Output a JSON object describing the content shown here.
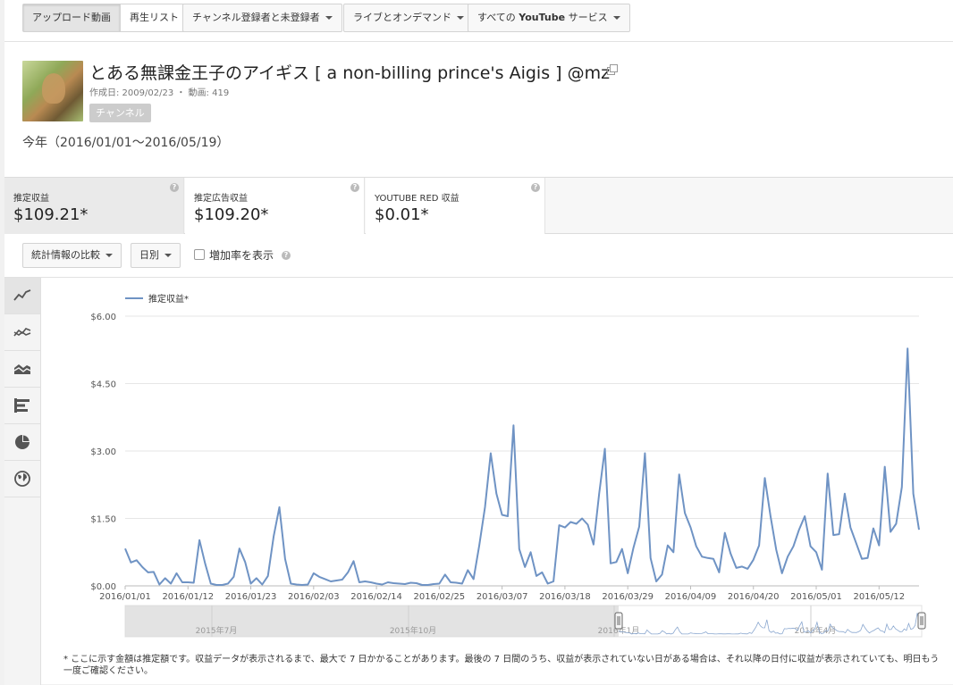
{
  "filter_bar": {
    "upload_videos": "アップロード動画",
    "playlists": "再生リスト",
    "subscribers_filter": "チャンネル登録者と未登録者",
    "live_filter": "ライブとオンデマンド",
    "services_prefix": "すべての ",
    "services_bold": "YouTube",
    "services_suffix": " サービス"
  },
  "channel": {
    "title": "とある無課金王子のアイギス [ a non-billing prince's Aigis ] @mz",
    "meta": "作成日: 2009/02/23 ・ 動画: 419",
    "badge": "チャンネル",
    "period": "今年（2016/01/01〜2016/05/19）"
  },
  "metrics": [
    {
      "label": "推定収益",
      "value": "$109.21*"
    },
    {
      "label": "推定広告収益",
      "value": "$109.20*"
    },
    {
      "label": "YOUTUBE RED 収益",
      "value": "$0.01*"
    }
  ],
  "controls": {
    "compare": "統計情報の比較",
    "granularity": "日別",
    "growth_label": "増加率を表示"
  },
  "side_tools": [
    "line-chart-icon",
    "multi-line-chart-icon",
    "stacked-area-chart-icon",
    "bar-chart-icon",
    "pie-chart-icon",
    "globe-map-icon"
  ],
  "chart_data": {
    "type": "line",
    "title": "",
    "legend": "推定収益*",
    "legend_position": "top-left",
    "grid": true,
    "ylim": [
      0,
      6
    ],
    "y_ticks": [
      "$0.00",
      "$1.50",
      "$3.00",
      "$4.50",
      "$6.00"
    ],
    "x_ticks": [
      "2016/01/01",
      "2016/01/12",
      "2016/01/23",
      "2016/02/03",
      "2016/02/14",
      "2016/02/25",
      "2016/03/07",
      "2016/03/18",
      "2016/03/29",
      "2016/04/09",
      "2016/04/20",
      "2016/05/01",
      "2016/05/12"
    ],
    "x_start": "2016/01/01",
    "x_end": "2016/05/19",
    "series": [
      {
        "name": "推定収益*",
        "color": "#6f93c4",
        "values": [
          0.83,
          0.52,
          0.57,
          0.42,
          0.3,
          0.31,
          0.03,
          0.17,
          0.05,
          0.28,
          0.08,
          0.08,
          0.07,
          1.02,
          0.5,
          0.05,
          0.02,
          0.02,
          0.05,
          0.2,
          0.83,
          0.53,
          0.05,
          0.17,
          0.03,
          0.22,
          1.1,
          1.75,
          0.6,
          0.05,
          0.03,
          0.02,
          0.03,
          0.28,
          0.2,
          0.15,
          0.1,
          0.12,
          0.14,
          0.3,
          0.55,
          0.08,
          0.1,
          0.08,
          0.05,
          0.03,
          0.08,
          0.06,
          0.05,
          0.04,
          0.07,
          0.06,
          0.02,
          0.02,
          0.04,
          0.05,
          0.25,
          0.08,
          0.07,
          0.05,
          0.35,
          0.15,
          0.9,
          1.75,
          2.95,
          2.05,
          1.58,
          1.55,
          3.57,
          0.82,
          0.42,
          0.75,
          0.22,
          0.3,
          0.05,
          0.1,
          1.35,
          1.3,
          1.42,
          1.38,
          1.5,
          1.36,
          0.92,
          2.05,
          3.05,
          0.5,
          0.53,
          0.82,
          0.28,
          0.85,
          1.32,
          2.95,
          0.62,
          0.1,
          0.25,
          0.9,
          0.75,
          2.48,
          1.62,
          1.3,
          0.88,
          0.65,
          0.62,
          0.6,
          0.3,
          1.18,
          0.72,
          0.4,
          0.43,
          0.38,
          0.58,
          0.9,
          2.4,
          1.55,
          0.8,
          0.28,
          0.65,
          0.88,
          1.25,
          1.55,
          0.88,
          0.75,
          0.36,
          2.5,
          1.13,
          1.15,
          2.05,
          1.3,
          0.95,
          0.6,
          0.62,
          1.28,
          0.9,
          2.65,
          1.2,
          1.38,
          2.2,
          5.28,
          2.05,
          1.25
        ]
      }
    ],
    "navigator": {
      "labels": [
        "2015年7月",
        "2015年10月",
        "2016年1月",
        "2016年4月"
      ]
    }
  },
  "footnote": "* ここに示す金額は推定額です。収益データが表示されるまで、最大で 7 日かかることがあります。最後の 7 日間のうち、収益が表示されていない日がある場合は、それ以降の日付に収益が表示されていても、明日もう一度ご確認ください。"
}
